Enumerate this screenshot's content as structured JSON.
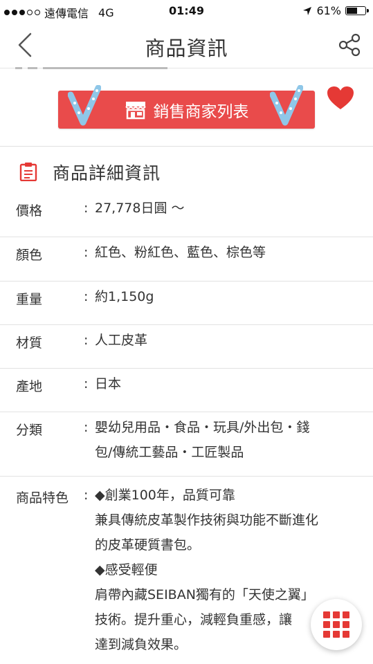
{
  "status_bar": {
    "carrier": "遠傳電信",
    "network": "4G",
    "time": "01:49",
    "battery": "61%",
    "battery_level": 0.61
  },
  "nav": {
    "title": "商品資訊",
    "back_icon": "chevron-left-icon",
    "share_icon": "share-icon"
  },
  "seller": {
    "button_label": "銷售商家列表",
    "store_icon": "store-icon",
    "favorite_icon": "heart-icon"
  },
  "details": {
    "title": "商品詳細資訊",
    "rows": [
      {
        "label": "價格",
        "value": [
          "27,778日圓 ～"
        ]
      },
      {
        "label": "顏色",
        "value": [
          "紅色、粉紅色、藍色、棕色等"
        ]
      },
      {
        "label": "重量",
        "value": [
          "約1,150g"
        ]
      },
      {
        "label": "材質",
        "value": [
          "人工皮革"
        ]
      },
      {
        "label": "產地",
        "value": [
          "日本"
        ]
      },
      {
        "label": "分類",
        "value": [
          "嬰幼兒用品・食品・玩具/外出包・錢",
          "包/傳統工藝品・工匠製品"
        ]
      },
      {
        "label": "商品特色",
        "value": [
          "◆創業100年，品質可靠",
          "兼具傳統皮革製作技術與功能不斷進化",
          "的皮革硬質書包。",
          "◆感受輕便",
          "肩帶內藏SEIBAN獨有的「天使之翼」",
          "技術。提升重心，減輕負重感，讓",
          "達到減負效果。"
        ]
      }
    ]
  },
  "colors": {
    "accent": "#e94b4b",
    "heart": "#e53935"
  },
  "fab": {
    "icon": "grid-menu-icon"
  }
}
